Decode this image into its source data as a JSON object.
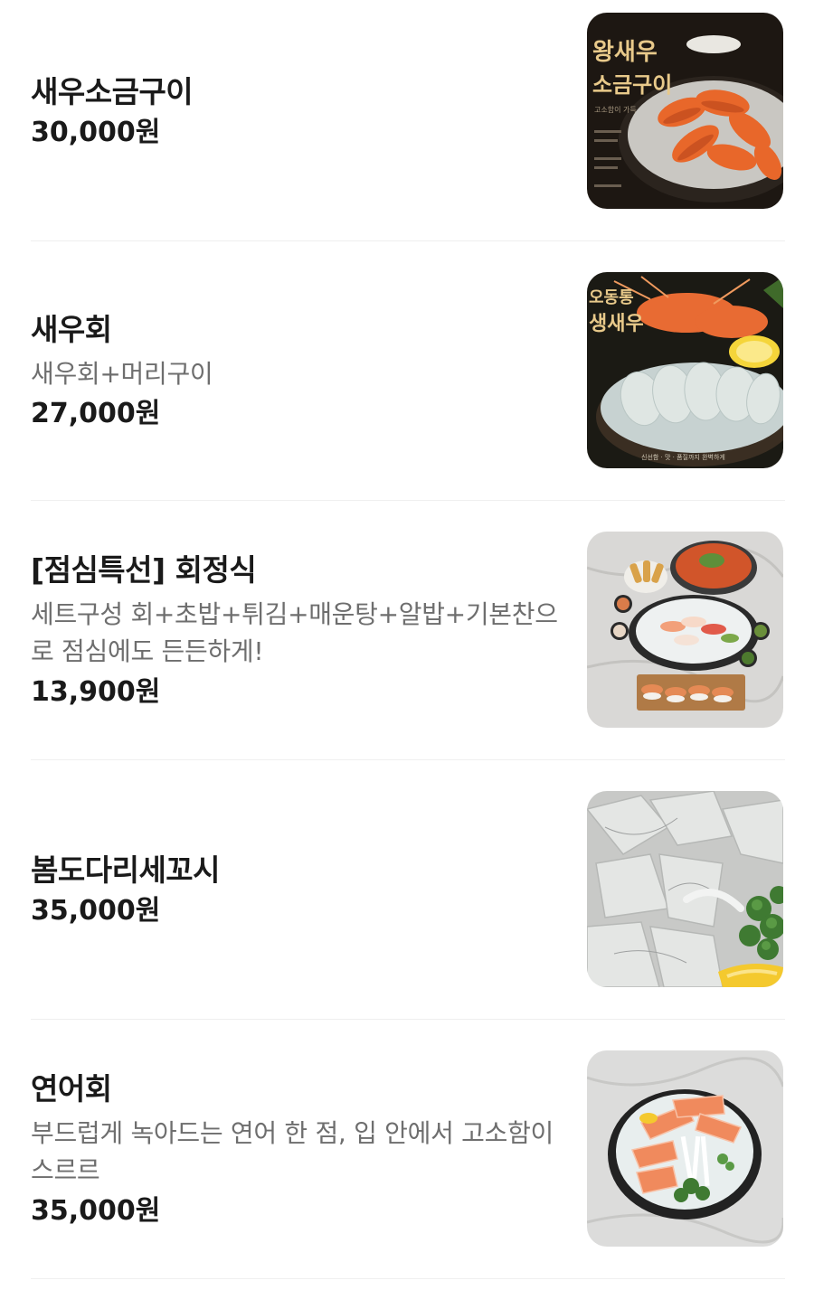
{
  "menu": {
    "items": [
      {
        "name": "새우소금구이",
        "description": "",
        "price": "30,000원",
        "image": {
          "title_line1": "왕새우",
          "title_line2": "소금구이",
          "tagline": "고소함이 가득",
          "colors": {
            "bg": "#1d1712",
            "shrimp": "#e8672a",
            "foil": "#c9c7c2",
            "text": "#e8c98a"
          }
        }
      },
      {
        "name": "새우회",
        "description": "새우회+머리구이",
        "price": "27,000원",
        "image": {
          "title_line1": "오동통",
          "title_line2": "생새우",
          "caption": "신선함 · 맛 · 품질까지 완벽하게",
          "colors": {
            "bg": "#1b1a14",
            "shrimp": "#dfe6e3",
            "ice": "#c7d2d1",
            "lemon": "#f5d53a",
            "text": "#e8c98a"
          }
        }
      },
      {
        "name": "[점심특선] 회정식",
        "description": "세트구성 회+초밥+튀김+매운탕+알밥+기본찬으로 점심에도 든든하게!",
        "price": "13,900원",
        "image": {
          "colors": {
            "bg": "#d9d8d6",
            "stew": "#d1552a",
            "plate": "#2a2a2a",
            "sushi": "#e58a55"
          }
        }
      },
      {
        "name": "봄도다리세꼬시",
        "description": "",
        "price": "35,000원",
        "image": {
          "colors": {
            "bg": "#c8c9c7",
            "fish": "#e4e6e4",
            "greens": "#3f7a32",
            "lemon": "#f4c92e"
          }
        }
      },
      {
        "name": "연어회",
        "description": "부드럽게 녹아드는 연어 한 점, 입 안에서 고소함이 스르르",
        "price": "35,000원",
        "image": {
          "colors": {
            "bg": "#dcdcdb",
            "plate": "#222222",
            "salmon": "#f08a5d",
            "greens": "#3f7a32"
          }
        }
      }
    ]
  }
}
